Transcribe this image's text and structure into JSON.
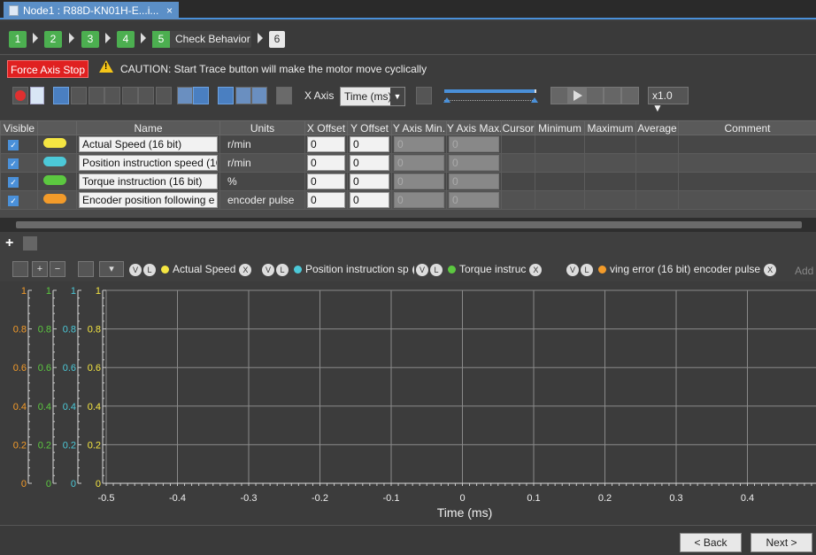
{
  "tab": {
    "title": "Node1 : R88D-KN01H-E...i...",
    "close": "×"
  },
  "steps": [
    {
      "num": "1"
    },
    {
      "num": "2"
    },
    {
      "num": "3"
    },
    {
      "num": "4"
    },
    {
      "num": "5",
      "label": "Check Behavior"
    },
    {
      "num": "6"
    }
  ],
  "controls": {
    "force_stop": "Force Axis Stop",
    "caution": "CAUTION: Start Trace button will make the motor move cyclically",
    "warn_symbol": "!",
    "xaxis_label": "X Axis",
    "xaxis_value": "Time (ms)",
    "zoom_value": "x1.0",
    "slider_level": 0.98
  },
  "grid": {
    "headers": [
      "Visible",
      "",
      "Name",
      "Units",
      "X Offset",
      "Y Offset",
      "Y Axis Min.",
      "Y Axis Max.",
      "Cursor",
      "Minimum",
      "Maximum",
      "Average",
      "Comment"
    ],
    "rows": [
      {
        "visible": true,
        "color": "#f5e642",
        "name": "Actual Speed (16 bit)",
        "units": "r/min",
        "x_offset": "0",
        "y_offset": "0",
        "y_min": "0",
        "y_max": "0"
      },
      {
        "visible": true,
        "color": "#4cc9d8",
        "name": "Position instruction speed (16",
        "units": "r/min",
        "x_offset": "0",
        "y_offset": "0",
        "y_min": "0",
        "y_max": "0"
      },
      {
        "visible": true,
        "color": "#5cc840",
        "name": "Torque instruction (16 bit)",
        "units": "%",
        "x_offset": "0",
        "y_offset": "0",
        "y_min": "0",
        "y_max": "0"
      },
      {
        "visible": true,
        "color": "#f39b2a",
        "name": "Encoder position following e",
        "units": "encoder pulse",
        "x_offset": "0",
        "y_offset": "0",
        "y_min": "0",
        "y_max": "0"
      }
    ]
  },
  "legend": {
    "v": "V",
    "l": "L",
    "x": "X",
    "items": [
      {
        "label": "Actual Speed",
        "color": "#f5e642"
      },
      {
        "label": "Position instruction sp",
        "color": "#4cc9d8"
      },
      {
        "label": "Torque instruc",
        "color": "#5cc840"
      },
      {
        "label": "ving error (16 bit) encoder pulse",
        "color": "#f39b2a"
      }
    ],
    "add_label": "Add"
  },
  "chart_data": {
    "type": "line",
    "xlabel": "Time (ms)",
    "ylabel": "",
    "xlim": [
      -0.6,
      0.5
    ],
    "xticks": [
      -0.5,
      -0.4,
      -0.3,
      -0.2,
      -0.1,
      0,
      0.1,
      0.2,
      0.3,
      0.4
    ],
    "xtick_labels": [
      "-0.5",
      "-0.4",
      "-0.3",
      "-0.2",
      "-0.1",
      "0",
      "0.1",
      "0.2",
      "0.3",
      "0.4"
    ],
    "ylim": [
      0,
      1
    ],
    "yaxes": [
      {
        "color": "#f39b2a",
        "ticks": [
          {
            "v": 1,
            "t": "1"
          },
          {
            "v": 0.8,
            "t": "0.8"
          },
          {
            "v": 0.6,
            "t": "0.6"
          },
          {
            "v": 0.4,
            "t": "0.4"
          },
          {
            "v": 0.2,
            "t": "0.2"
          },
          {
            "v": 0,
            "t": "0"
          }
        ]
      },
      {
        "color": "#5cc840",
        "ticks": [
          {
            "v": 1,
            "t": "1"
          },
          {
            "v": 0.8,
            "t": "0.8"
          },
          {
            "v": 0.6,
            "t": "0.6"
          },
          {
            "v": 0.4,
            "t": "0.4"
          },
          {
            "v": 0.2,
            "t": "0.2"
          },
          {
            "v": 0,
            "t": "0"
          }
        ]
      },
      {
        "color": "#4cc9d8",
        "ticks": [
          {
            "v": 1,
            "t": "1"
          },
          {
            "v": 0.8,
            "t": "0.8"
          },
          {
            "v": 0.6,
            "t": "0.6"
          },
          {
            "v": 0.4,
            "t": "0.4"
          },
          {
            "v": 0.2,
            "t": "0.2"
          },
          {
            "v": 0,
            "t": "0"
          }
        ]
      },
      {
        "color": "#f5e642",
        "ticks": [
          {
            "v": 1,
            "t": "1"
          },
          {
            "v": 0.8,
            "t": "0.8"
          },
          {
            "v": 0.6,
            "t": "0.6"
          },
          {
            "v": 0.4,
            "t": "0.4"
          },
          {
            "v": 0.2,
            "t": "0.2"
          },
          {
            "v": 0,
            "t": "0"
          }
        ]
      }
    ],
    "grid": true,
    "series": []
  },
  "nav": {
    "back": "< Back",
    "next": "Next >"
  }
}
